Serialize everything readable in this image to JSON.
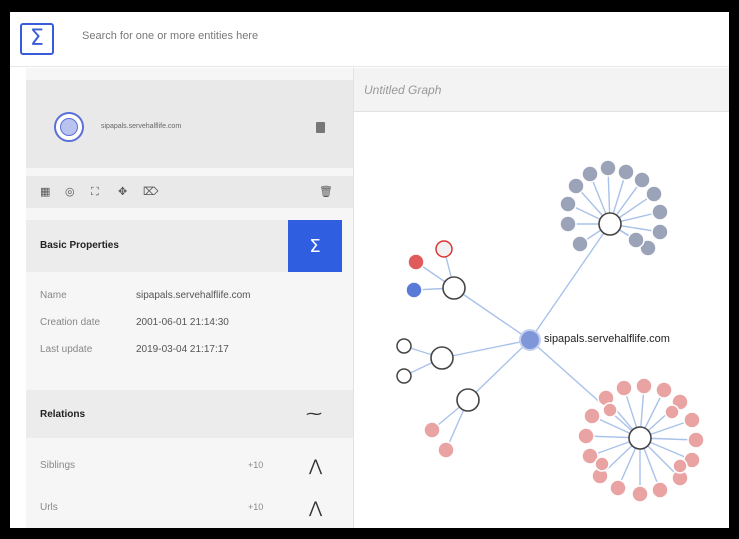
{
  "header": {
    "logo_glyph": "Σ",
    "search_placeholder": "Search for one or more entities here"
  },
  "entity": {
    "name": "sipapals.servehalflife.com",
    "icon": "globe-icon"
  },
  "toolbar": {
    "tools": [
      "grid-icon",
      "target-icon",
      "expand-icon",
      "pin-icon",
      "tag-icon"
    ],
    "delete_icon": "trash-icon"
  },
  "properties": {
    "title": "Basic Properties",
    "maltego_glyph": "Σ",
    "accent": "#2f5fe0",
    "rows": [
      {
        "key": "Name",
        "value": "sipapals.servehalflife.com"
      },
      {
        "key": "Creation date",
        "value": "2001-06-01 21:14:30"
      },
      {
        "key": "Last update",
        "value": "2019-03-04 21:17:17"
      }
    ]
  },
  "relations": {
    "title": "Relations",
    "items": [
      {
        "label": "Siblings",
        "count": "+10"
      },
      {
        "label": "Urls",
        "count": "+10"
      }
    ]
  },
  "graph": {
    "title": "Untitled Graph",
    "center_label": "sipapals.servehalflife.com",
    "edge_color": "#a9c2ea",
    "node_gray": "#9aa3b8",
    "node_pink": "#e9a3a3"
  }
}
